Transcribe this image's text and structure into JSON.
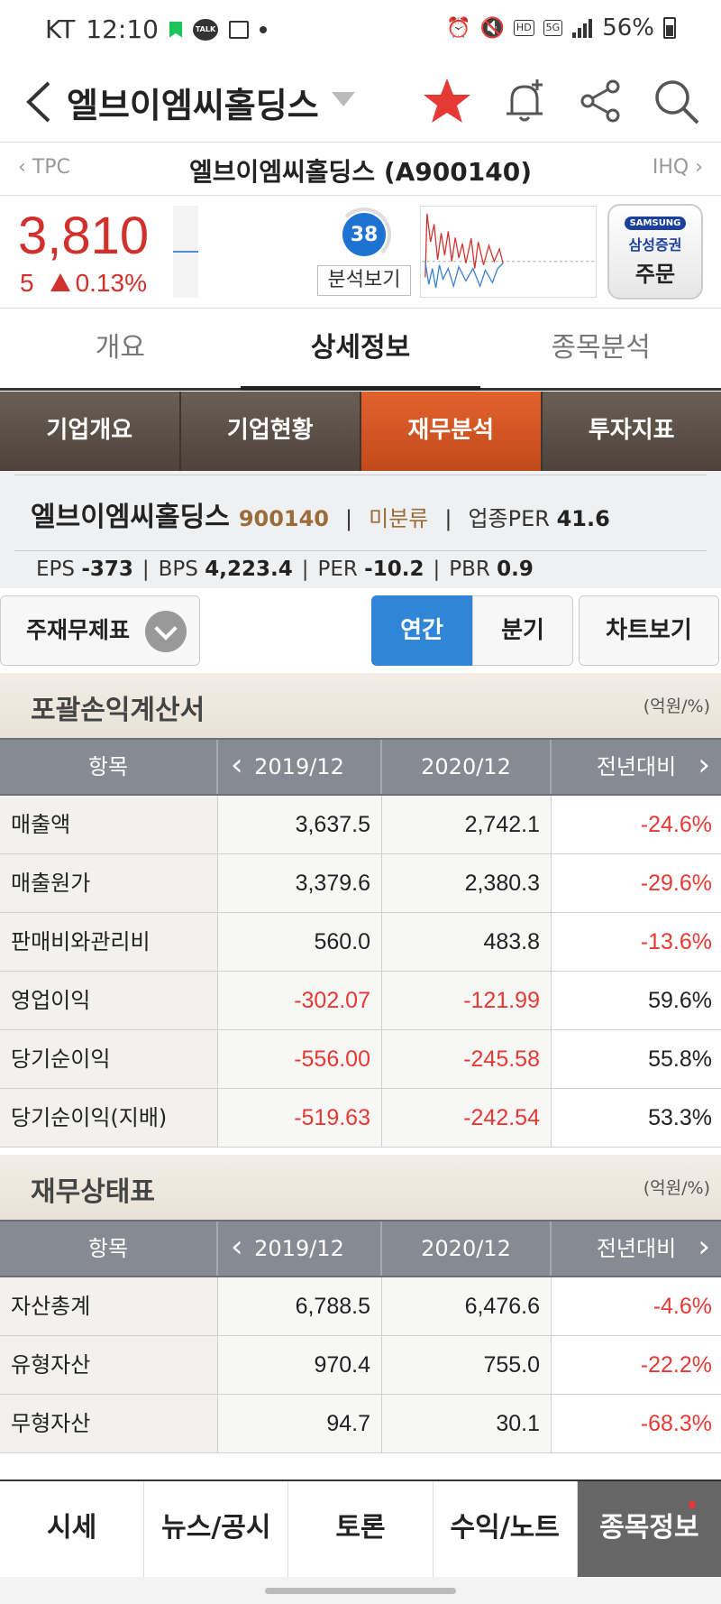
{
  "status": {
    "carrier": "KT",
    "time": "12:10",
    "talk": "TALK",
    "hd": "HD",
    "net": "5G",
    "battery": "56%"
  },
  "appbar": {
    "title": "엘브이엠씨홀딩스"
  },
  "subnav": {
    "prev": "‹ TPC",
    "next": "IHQ ›",
    "stock_title": "엘브이엠씨홀딩스 (A900140)"
  },
  "price": {
    "current": "3,810",
    "change_amount": "5",
    "change_pct": "0.13%",
    "analysis_score": "38",
    "analysis_label": "분석보기",
    "order_brand": "SAMSUNG",
    "order_sub": "삼성증권",
    "order_label": "주문"
  },
  "main_tabs": [
    "개요",
    "상세정보",
    "종목분석"
  ],
  "sub_tabs": [
    "기업개요",
    "기업현황",
    "재무분석",
    "투자지표"
  ],
  "company": {
    "name": "엘브이엠씨홀딩스",
    "code": "900140",
    "category": "미분류",
    "industry_per_label": "업종PER",
    "industry_per": "41.6",
    "eps_label": "EPS",
    "eps": "-373",
    "bps_label": "BPS",
    "bps": "4,223.4",
    "per_label": "PER",
    "per": "-10.2",
    "pbr_label": "PBR",
    "pbr": "0.9"
  },
  "controls": {
    "select_label": "주재무제표",
    "annual": "연간",
    "quarter": "분기",
    "chart": "차트보기"
  },
  "income": {
    "title": "포괄손익계산서",
    "unit": "(억원/%)",
    "headers": [
      "항목",
      "2019/12",
      "2020/12",
      "전년대비"
    ],
    "rows": [
      [
        "매출액",
        "3,637.5",
        "2,742.1",
        "-24.6%"
      ],
      [
        "매출원가",
        "3,379.6",
        "2,380.3",
        "-29.6%"
      ],
      [
        "판매비와관리비",
        "560.0",
        "483.8",
        "-13.6%"
      ],
      [
        "영업이익",
        "-302.07",
        "-121.99",
        "59.6%"
      ],
      [
        "당기순이익",
        "-556.00",
        "-245.58",
        "55.8%"
      ],
      [
        "당기순이익(지배)",
        "-519.63",
        "-242.54",
        "53.3%"
      ]
    ]
  },
  "balance": {
    "title": "재무상태표",
    "unit": "(억원/%)",
    "headers": [
      "항목",
      "2019/12",
      "2020/12",
      "전년대비"
    ],
    "rows": [
      [
        "자산총계",
        "6,788.5",
        "6,476.6",
        "-4.6%"
      ],
      [
        "유형자산",
        "970.4",
        "755.0",
        "-22.2%"
      ],
      [
        "무형자산",
        "94.7",
        "30.1",
        "-68.3%"
      ]
    ]
  },
  "bottom_nav": [
    "시세",
    "뉴스/공시",
    "토론",
    "수익/노트",
    "종목정보"
  ],
  "colors": {
    "price_up": "#d0312d",
    "negative": "#e53935",
    "accent_blue": "#2f86d6",
    "active_subtab": "#d4561f"
  }
}
